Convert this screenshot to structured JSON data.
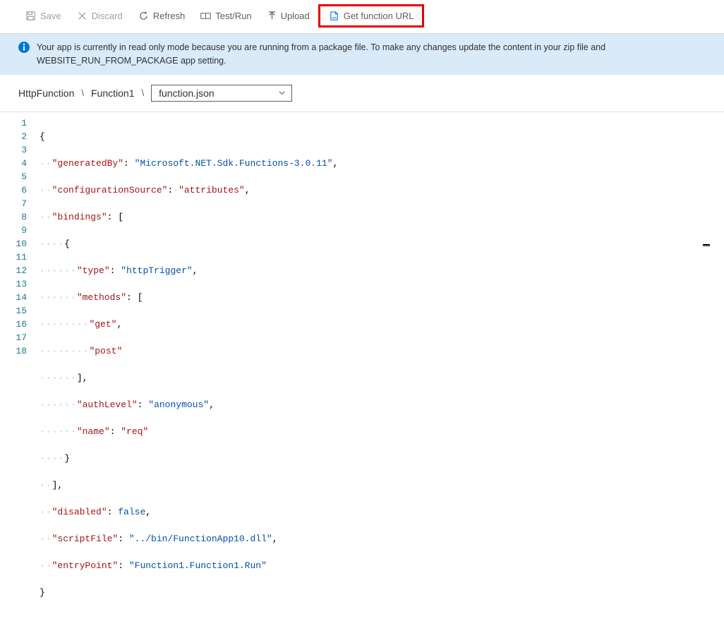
{
  "toolbar": {
    "save": "Save",
    "discard": "Discard",
    "refresh": "Refresh",
    "test": "Test/Run",
    "upload": "Upload",
    "geturl": "Get function URL"
  },
  "info": {
    "text": "Your app is currently in read only mode because you are running from a package file. To make any changes update the content in your zip file and WEBSITE_RUN_FROM_PACKAGE app setting."
  },
  "breadcrumb": {
    "root": "HttpFunction",
    "func": "Function1",
    "file": "function.json"
  },
  "gutter": [
    "1",
    "2",
    "3",
    "4",
    "5",
    "6",
    "7",
    "8",
    "9",
    "10",
    "11",
    "12",
    "13",
    "14",
    "15",
    "16",
    "17",
    "18"
  ],
  "code": {
    "generatedBy_key": "\"generatedBy\"",
    "generatedBy_val": "\"Microsoft.NET.Sdk.Functions-3.0.11\"",
    "configSource_key": "\"configurationSource\"",
    "configSource_val": "\"attributes\"",
    "bindings_key": "\"bindings\"",
    "type_key": "\"type\"",
    "type_val": "\"httpTrigger\"",
    "methods_key": "\"methods\"",
    "get_val": "\"get\"",
    "post_val": "\"post\"",
    "authLevel_key": "\"authLevel\"",
    "authLevel_val": "\"anonymous\"",
    "name_key": "\"name\"",
    "name_val": "\"req\"",
    "disabled_key": "\"disabled\"",
    "disabled_val": "false",
    "scriptFile_key": "\"scriptFile\"",
    "scriptFile_val": "\"../bin/FunctionApp10.dll\"",
    "entryPoint_key": "\"entryPoint\"",
    "entryPoint_val": "\"Function1.Function1.Run\""
  }
}
